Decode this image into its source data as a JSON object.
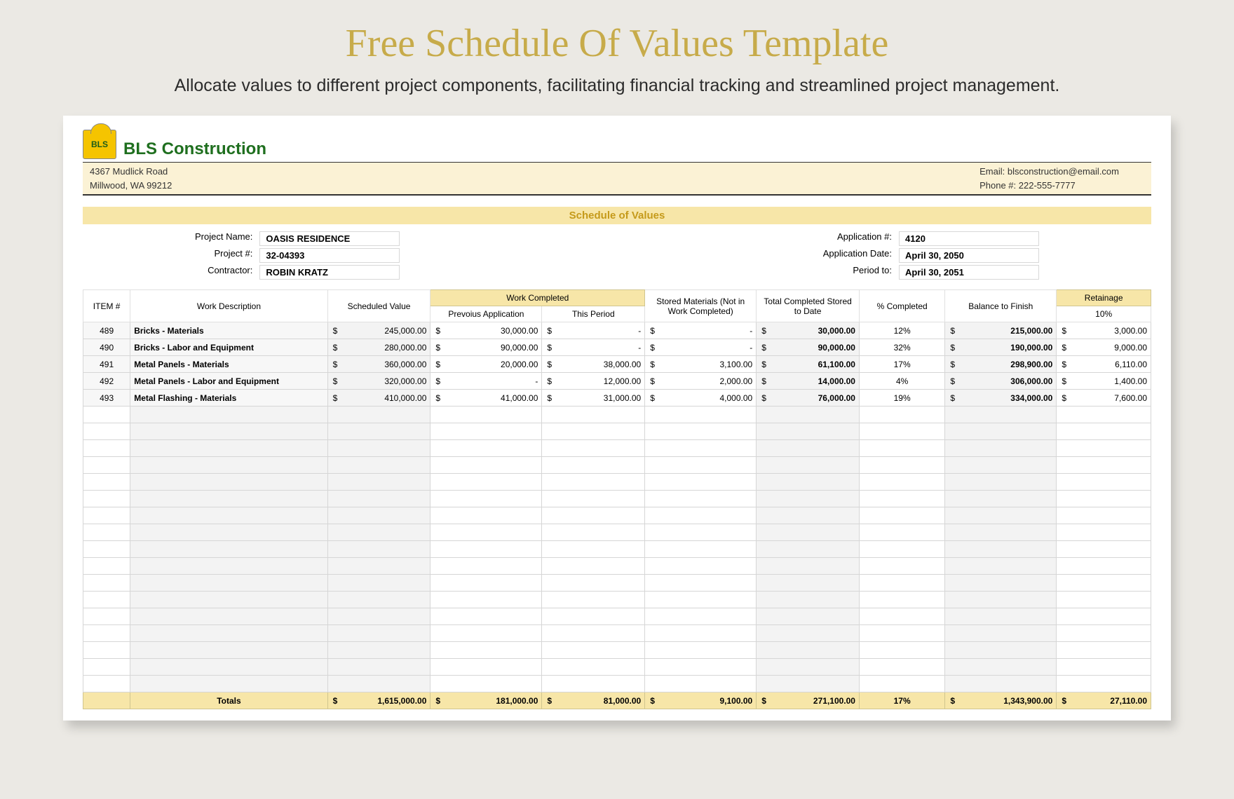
{
  "page": {
    "title": "Free Schedule Of Values Template",
    "subtitle": "Allocate values to different project components, facilitating financial tracking and streamlined project management."
  },
  "company": {
    "name": "BLS Construction",
    "logo_text": "BLS",
    "address_line1": "4367 Mudlick Road",
    "address_line2": "Millwood, WA 99212",
    "email_label": "Email: ",
    "email": "blsconstruction@email.com",
    "phone_label": "Phone #: ",
    "phone": "222-555-7777"
  },
  "sov_title": "Schedule of Values",
  "meta_left": {
    "project_name_label": "Project Name:",
    "project_name": "OASIS RESIDENCE",
    "project_num_label": "Project #:",
    "project_num": "32-04393",
    "contractor_label": "Contractor:",
    "contractor": "ROBIN KRATZ"
  },
  "meta_right": {
    "app_num_label": "Application #:",
    "app_num": "4120",
    "app_date_label": "Application Date:",
    "app_date": "April 30, 2050",
    "period_to_label": "Period to:",
    "period_to": "April 30, 2051"
  },
  "headers": {
    "item": "ITEM #",
    "work_desc": "Work Description",
    "scheduled": "Scheduled Value",
    "work_completed": "Work Completed",
    "prev_app": "Prevoius Application",
    "this_period": "This Period",
    "stored": "Stored Materials (Not in Work Completed)",
    "total_completed": "Total Completed Stored to Date",
    "pct": "% Completed",
    "balance": "Balance to Finish",
    "retainage": "Retainage",
    "retainage_pct": "10%"
  },
  "rows": [
    {
      "item": "489",
      "desc": "Bricks - Materials",
      "sched": "245,000.00",
      "prev": "30,000.00",
      "period": "-",
      "stored": "-",
      "total": "30,000.00",
      "pct": "12%",
      "bal": "215,000.00",
      "ret": "3,000.00"
    },
    {
      "item": "490",
      "desc": "Bricks - Labor and Equipment",
      "sched": "280,000.00",
      "prev": "90,000.00",
      "period": "-",
      "stored": "-",
      "total": "90,000.00",
      "pct": "32%",
      "bal": "190,000.00",
      "ret": "9,000.00"
    },
    {
      "item": "491",
      "desc": "Metal Panels - Materials",
      "sched": "360,000.00",
      "prev": "20,000.00",
      "period": "38,000.00",
      "stored": "3,100.00",
      "total": "61,100.00",
      "pct": "17%",
      "bal": "298,900.00",
      "ret": "6,110.00"
    },
    {
      "item": "492",
      "desc": "Metal Panels - Labor and Equipment",
      "sched": "320,000.00",
      "prev": "-",
      "period": "12,000.00",
      "stored": "2,000.00",
      "total": "14,000.00",
      "pct": "4%",
      "bal": "306,000.00",
      "ret": "1,400.00"
    },
    {
      "item": "493",
      "desc": "Metal Flashing - Materials",
      "sched": "410,000.00",
      "prev": "41,000.00",
      "period": "31,000.00",
      "stored": "4,000.00",
      "total": "76,000.00",
      "pct": "19%",
      "bal": "334,000.00",
      "ret": "7,600.00"
    }
  ],
  "totals": {
    "label": "Totals",
    "sched": "1,615,000.00",
    "prev": "181,000.00",
    "period": "81,000.00",
    "stored": "9,100.00",
    "total": "271,100.00",
    "pct": "17%",
    "bal": "1,343,900.00",
    "ret": "27,110.00"
  },
  "empty_rows": 17
}
